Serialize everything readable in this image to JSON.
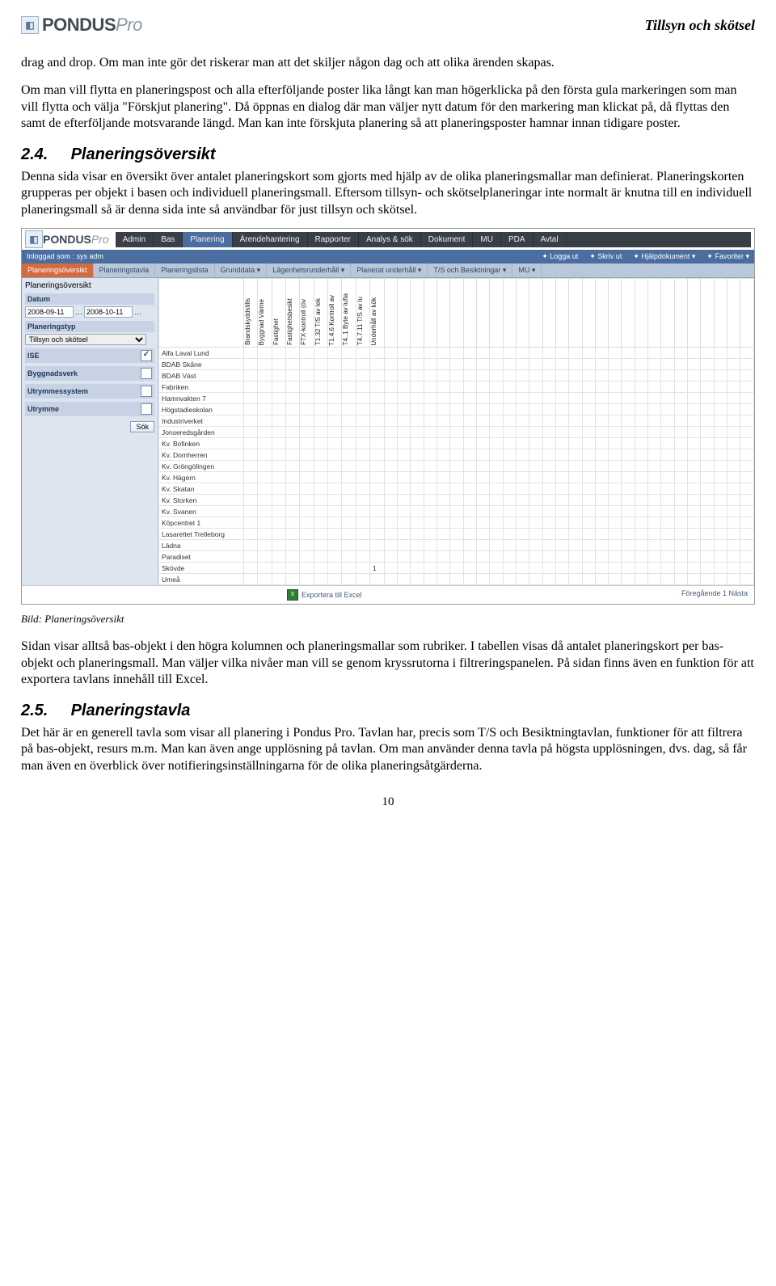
{
  "header": {
    "logo_main": "PONDUS",
    "logo_suffix": "Pro",
    "page_title": "Tillsyn och skötsel"
  },
  "paras": {
    "p1": "drag and drop. Om man inte gör det riskerar man att det skiljer någon dag och att olika ärenden skapas.",
    "p2": "Om man vill flytta en planeringspost och alla efterföljande poster lika långt kan man högerklicka på den första gula markeringen som man vill flytta och välja \"Förskjut planering\". Då öppnas en dialog där man väljer nytt datum för den markering man klickat på, då flyttas den samt de efterföljande motsvarande längd. Man kan inte förskjuta planering så att planeringsposter hamnar innan tidigare poster.",
    "s24_num": "2.4.",
    "s24_title": "Planeringsöversikt",
    "s24_body": "Denna sida visar en översikt över antalet planeringskort som gjorts med hjälp av de olika planeringsmallar man definierat. Planeringskorten grupperas per objekt i basen och individuell planeringsmall. Eftersom tillsyn- och skötselplaneringar inte normalt är knutna till en individuell planeringsmall så är denna sida inte så användbar för just tillsyn och skötsel.",
    "caption1": "Bild: Planeringsöversikt",
    "p3": "Sidan visar alltså bas-objekt i den högra kolumnen och planeringsmallar som rubriker. I tabellen visas då antalet planeringskort per bas-objekt och planeringsmall. Man väljer vilka nivåer man vill se genom kryssrutorna i filtreringspanelen. På sidan finns även en funktion för att exportera tavlans innehåll till Excel.",
    "s25_num": "2.5.",
    "s25_title": "Planeringstavla",
    "s25_body": "Det här är en generell tavla som visar all planering i Pondus Pro. Tavlan har, precis som T/S och Besiktningtavlan, funktioner för att filtrera på bas-objekt, resurs m.m. Man kan även ange upplösning på tavlan. Om man använder denna tavla på högsta upplösningen, dvs. dag, så får man även en överblick över notifieringsinställningarna för de olika planeringsåtgärderna.",
    "page_number": "10"
  },
  "app": {
    "menus": [
      "Admin",
      "Bas",
      "Planering",
      "Ärendehantering",
      "Rapporter",
      "Analys & sök",
      "Dokument",
      "MU",
      "PDA",
      "Avtal"
    ],
    "active_menu": "Planering",
    "subbar_left": "Inloggad som :   sys adm",
    "subbar_right": [
      "Logga ut",
      "Skriv ut",
      "Hjälpdokument ▾",
      "Favoriter ▾"
    ],
    "tabs": [
      "Planeringsöversikt",
      "Planeringstavla",
      "Planeringslista",
      "Grunddata ▾",
      "Lägenhetsrunderhåll ▾",
      "Planerat underhåll ▾",
      "T/S och Besiktningar ▾",
      "MU ▾"
    ],
    "selected_tab": "Planeringsöversikt",
    "panel": {
      "title": "Planeringsöversikt",
      "lbl_datum": "Datum",
      "date_from": "2008-09-11",
      "date_to": "2008-10-11",
      "lbl_plantyp": "Planeringstyp",
      "plantyp_value": "Tillsyn och skötsel",
      "lbl_ise": "ISE",
      "lbl_bygg": "Byggnadsverk",
      "lbl_utr_sys": "Utrymmessystem",
      "lbl_utr": "Utrymme",
      "btn_sok": "Sök"
    },
    "col_headers": [
      "Brandskyddstills",
      "Byggnad Värme",
      "Fastighet",
      "Fastighetsbesikt",
      "FTX-kontroll (öv",
      "T1.32 T/S av lek",
      "T1.4.6 Kontroll av",
      "T4..1 Byte av lufta",
      "T4.7.11 T/S av lu",
      "Underhåll av kök"
    ],
    "rows": [
      "Alfa Laval Lund",
      "BDAB Skåne",
      "BDAB Väst",
      "Fabriken",
      "Hamnvakten 7",
      "Högstadieskolan",
      "Industriverket",
      "Jonseredsgården",
      "Kv. Bofinken",
      "Kv. Domherren",
      "Kv. Gröngölingen",
      "Kv. Hägern",
      "Kv. Skatan",
      "Kv. Storken",
      "Kv. Svanen",
      "Köpcentret 1",
      "Lasarettet Trelleborg",
      "Lädna",
      "Paradiset",
      "Skövde",
      "Umeå"
    ],
    "skovde_value_col": 9,
    "skovde_value": "1",
    "footer_export": "Exportera till Excel",
    "footer_right": "Föregående  1  Nästa"
  }
}
